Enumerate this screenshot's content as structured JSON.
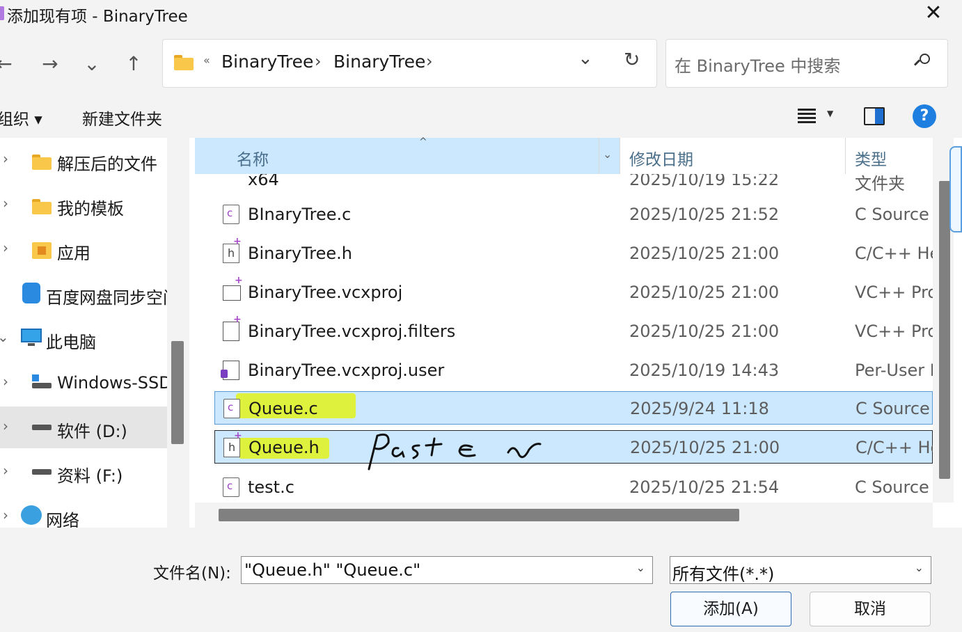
{
  "window": {
    "title": "添加现有项 - BinaryTree",
    "close_symbol": "✕"
  },
  "nav": {
    "back": "←",
    "forward": "→",
    "recent": "⌄",
    "up": "↑"
  },
  "address": {
    "overflow_chevron": "«",
    "crumbs": [
      "BinaryTree",
      "BinaryTree"
    ],
    "separator": "›",
    "dropdown": "⌄",
    "refresh": "↻"
  },
  "search": {
    "placeholder": "在 BinaryTree 中搜索"
  },
  "toolbar": {
    "organize_label": "组织 ▾",
    "new_folder_label": "新建文件夹",
    "view_dropdown": "▼",
    "help": "?"
  },
  "sidebar": {
    "items": [
      {
        "label": "解压后的文件",
        "icon": "folder-icon"
      },
      {
        "label": "我的模板",
        "icon": "folder-icon"
      },
      {
        "label": "应用",
        "icon": "app-folder-icon"
      },
      {
        "label": "百度网盘同步空间",
        "icon": "cloud-icon"
      },
      {
        "label": "此电脑",
        "icon": "computer-icon"
      },
      {
        "label": "Windows-SSD",
        "icon": "drive-icon"
      },
      {
        "label": "软件 (D:)",
        "icon": "drive-icon"
      },
      {
        "label": "资料 (F:)",
        "icon": "drive-icon"
      },
      {
        "label": "网络",
        "icon": "network-icon"
      }
    ],
    "expand_arrow": "›",
    "collapse_arrow": "⌄"
  },
  "columns": {
    "name": "名称",
    "date": "修改日期",
    "type": "类型",
    "sort_indicator": "^",
    "filter_dropdown": "⌄"
  },
  "files": [
    {
      "name": "x64",
      "date": "2025/10/19 15:22",
      "type": "文件夹",
      "icon": "folder-icon"
    },
    {
      "name": "BInaryTree.c",
      "date": "2025/10/25 21:52",
      "type": "C Source",
      "icon": "c-file-icon"
    },
    {
      "name": "BinaryTree.h",
      "date": "2025/10/25 21:00",
      "type": "C/C++ Header",
      "icon": "header-file-icon"
    },
    {
      "name": "BinaryTree.vcxproj",
      "date": "2025/10/25 21:00",
      "type": "VC++ Project",
      "icon": "project-file-icon"
    },
    {
      "name": "BinaryTree.vcxproj.filters",
      "date": "2025/10/25 21:00",
      "type": "VC++ Project Filters",
      "icon": "filters-file-icon"
    },
    {
      "name": "BinaryTree.vcxproj.user",
      "date": "2025/10/19 14:43",
      "type": "Per-User Project Options",
      "icon": "user-file-icon"
    },
    {
      "name": "Queue.c",
      "date": "2025/9/24 11:18",
      "type": "C Source",
      "icon": "c-file-icon"
    },
    {
      "name": "Queue.h",
      "date": "2025/10/25 21:00",
      "type": "C/C++ Header",
      "icon": "header-file-icon"
    },
    {
      "name": "test.c",
      "date": "2025/10/25 21:54",
      "type": "C Source",
      "icon": "c-file-icon"
    }
  ],
  "annotation": {
    "handwritten_text": "paste"
  },
  "footer": {
    "filename_label": "文件名(N):",
    "filename_value": "\"Queue.h\" \"Queue.c\"",
    "filter_value": "所有文件(*.*)",
    "add_button": "添加(A)",
    "cancel_button": "取消",
    "dropdown": "⌄"
  },
  "colors": {
    "selection": "#cce8ff",
    "highlighter": "#e0f21a",
    "accent": "#1f7fe0"
  }
}
